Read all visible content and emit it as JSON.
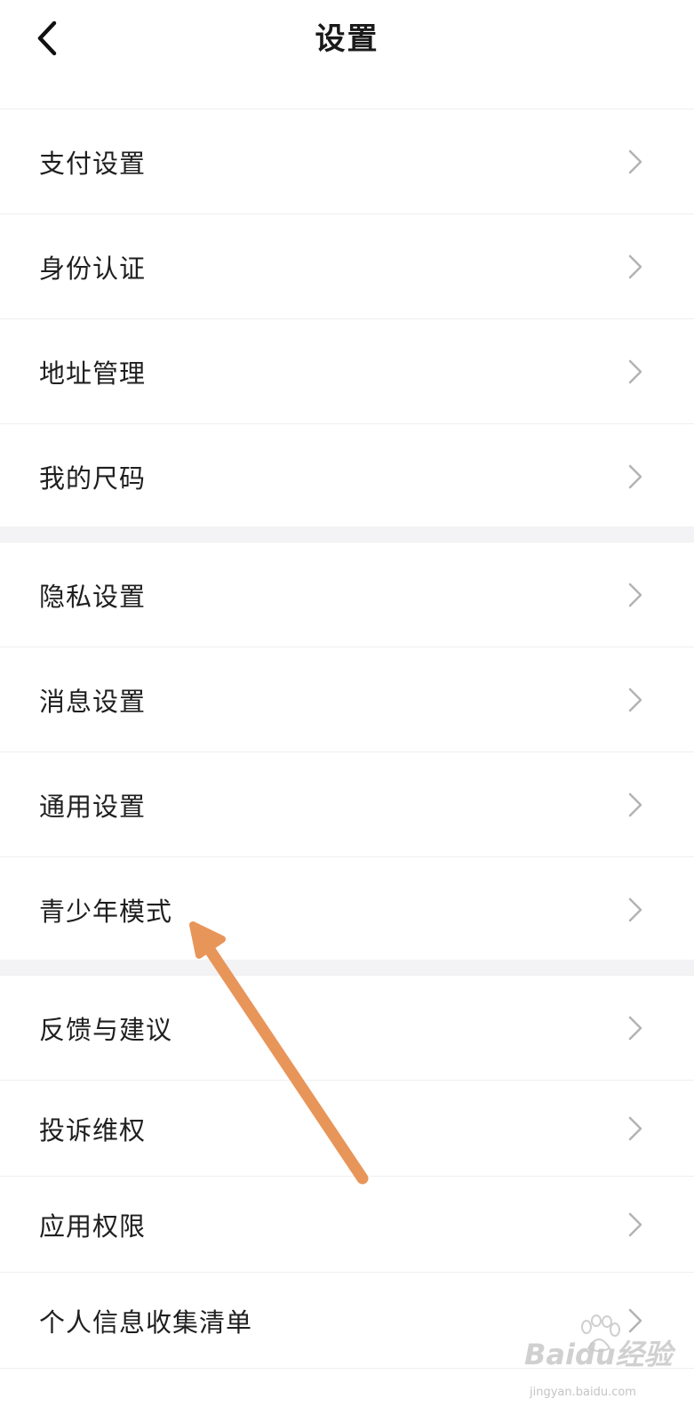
{
  "header": {
    "title": "设置",
    "back_icon": "chevron-left-icon"
  },
  "groups": [
    {
      "items": [
        {
          "label": "支付设置"
        },
        {
          "label": "身份认证"
        },
        {
          "label": "地址管理"
        },
        {
          "label": "我的尺码"
        }
      ]
    },
    {
      "items": [
        {
          "label": "隐私设置"
        },
        {
          "label": "消息设置"
        },
        {
          "label": "通用设置"
        },
        {
          "label": "青少年模式"
        }
      ]
    },
    {
      "items": [
        {
          "label": "反馈与建议"
        },
        {
          "label": "投诉维权"
        },
        {
          "label": "应用权限"
        },
        {
          "label": "个人信息收集清单"
        }
      ]
    }
  ],
  "annotation": {
    "color": "#E8955A",
    "points_to": "青少年模式"
  },
  "watermark": {
    "brand": "Baidu经验",
    "sub": "jingyan.baidu.com"
  },
  "colors": {
    "separator": "#f3f3f5",
    "chevron": "#b3b3b3",
    "text": "#1f1f1f"
  }
}
